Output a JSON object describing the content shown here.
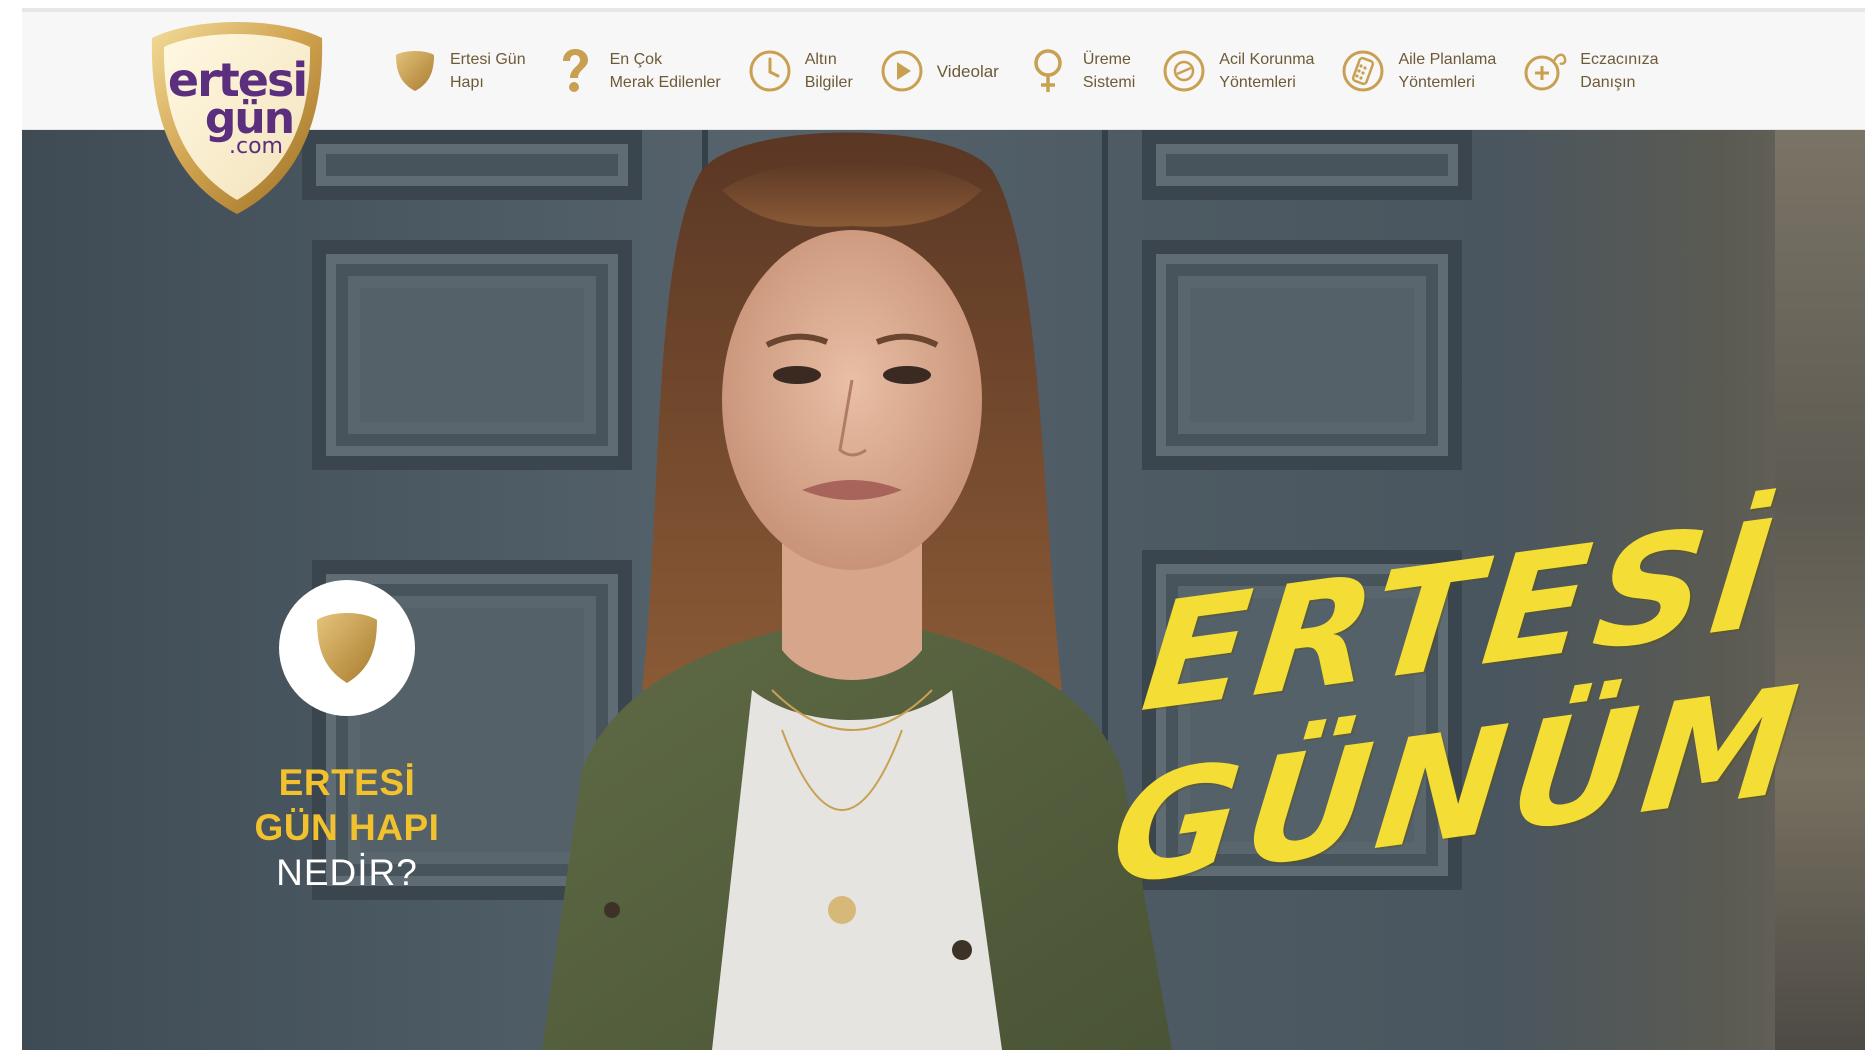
{
  "logo": {
    "line1": "ertesi",
    "line2": "gün",
    "line3": ".com"
  },
  "nav": {
    "items": [
      {
        "label": "Ertesi Gün\nHapı",
        "icon": "shield-icon"
      },
      {
        "label": "En Çok\nMerak Edilenler",
        "icon": "question-icon"
      },
      {
        "label": "Altın\nBilgiler",
        "icon": "clock-icon"
      },
      {
        "label": "Videolar",
        "icon": "play-icon"
      },
      {
        "label": "Üreme\nSistemi",
        "icon": "female-symbol-icon"
      },
      {
        "label": "Acil Korunma\nYöntemleri",
        "icon": "pill-icon"
      },
      {
        "label": "Aile Planlama\nYöntemleri",
        "icon": "pill-pack-icon"
      },
      {
        "label": "Eczacınıza\nDanışın",
        "icon": "stethoscope-icon"
      }
    ]
  },
  "hero": {
    "cta": {
      "line1": "ERTESİ",
      "line2": "GÜN HAPI",
      "line3": "NEDİR?"
    },
    "headline": {
      "word1": "ERTESİ",
      "word2": "GÜNÜM"
    }
  },
  "colors": {
    "gold": "#c9a052",
    "nav_text": "#6e5a37",
    "cta_yellow": "#f2c12e",
    "brush_yellow": "#f4dd35",
    "logo_purple": "#5b2e7e"
  }
}
